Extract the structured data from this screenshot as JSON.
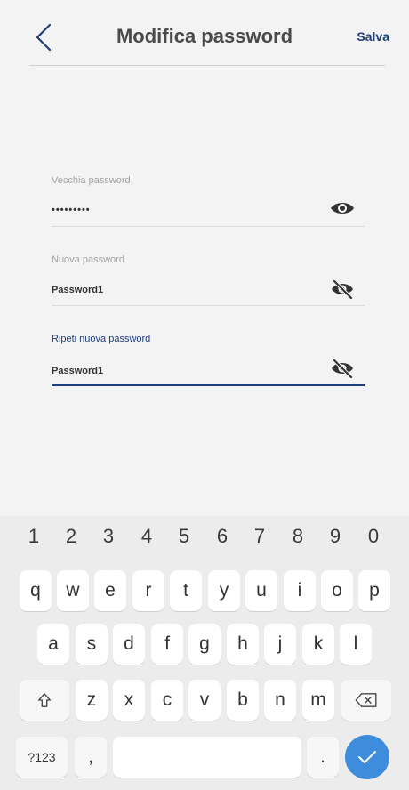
{
  "header": {
    "title": "Modifica password",
    "save_label": "Salva",
    "back_icon": "chevron-left-icon"
  },
  "fields": [
    {
      "label": "Vecchia password",
      "value": "•••••••••",
      "icon": "eye-icon",
      "active": false
    },
    {
      "label": "Nuova password",
      "value": "Password1",
      "icon": "eye-off-icon",
      "active": false
    },
    {
      "label": "Ripeti nuova password",
      "value": "Password1",
      "icon": "eye-off-icon",
      "active": true
    }
  ],
  "keyboard": {
    "numbers": [
      "1",
      "2",
      "3",
      "4",
      "5",
      "6",
      "7",
      "8",
      "9",
      "0"
    ],
    "row1": [
      "q",
      "w",
      "e",
      "r",
      "t",
      "y",
      "u",
      "i",
      "o",
      "p"
    ],
    "row2": [
      "a",
      "s",
      "d",
      "f",
      "g",
      "h",
      "j",
      "k",
      "l"
    ],
    "row3": [
      "z",
      "x",
      "c",
      "v",
      "b",
      "n",
      "m"
    ],
    "symbols_label": "?123",
    "comma_label": ",",
    "period_label": ".",
    "shift_icon": "shift-icon",
    "backspace_icon": "backspace-icon",
    "enter_icon": "check-icon"
  },
  "colors": {
    "accent": "#1f3f7a",
    "enter": "#3d8ddc",
    "background": "#f3f3f3"
  }
}
